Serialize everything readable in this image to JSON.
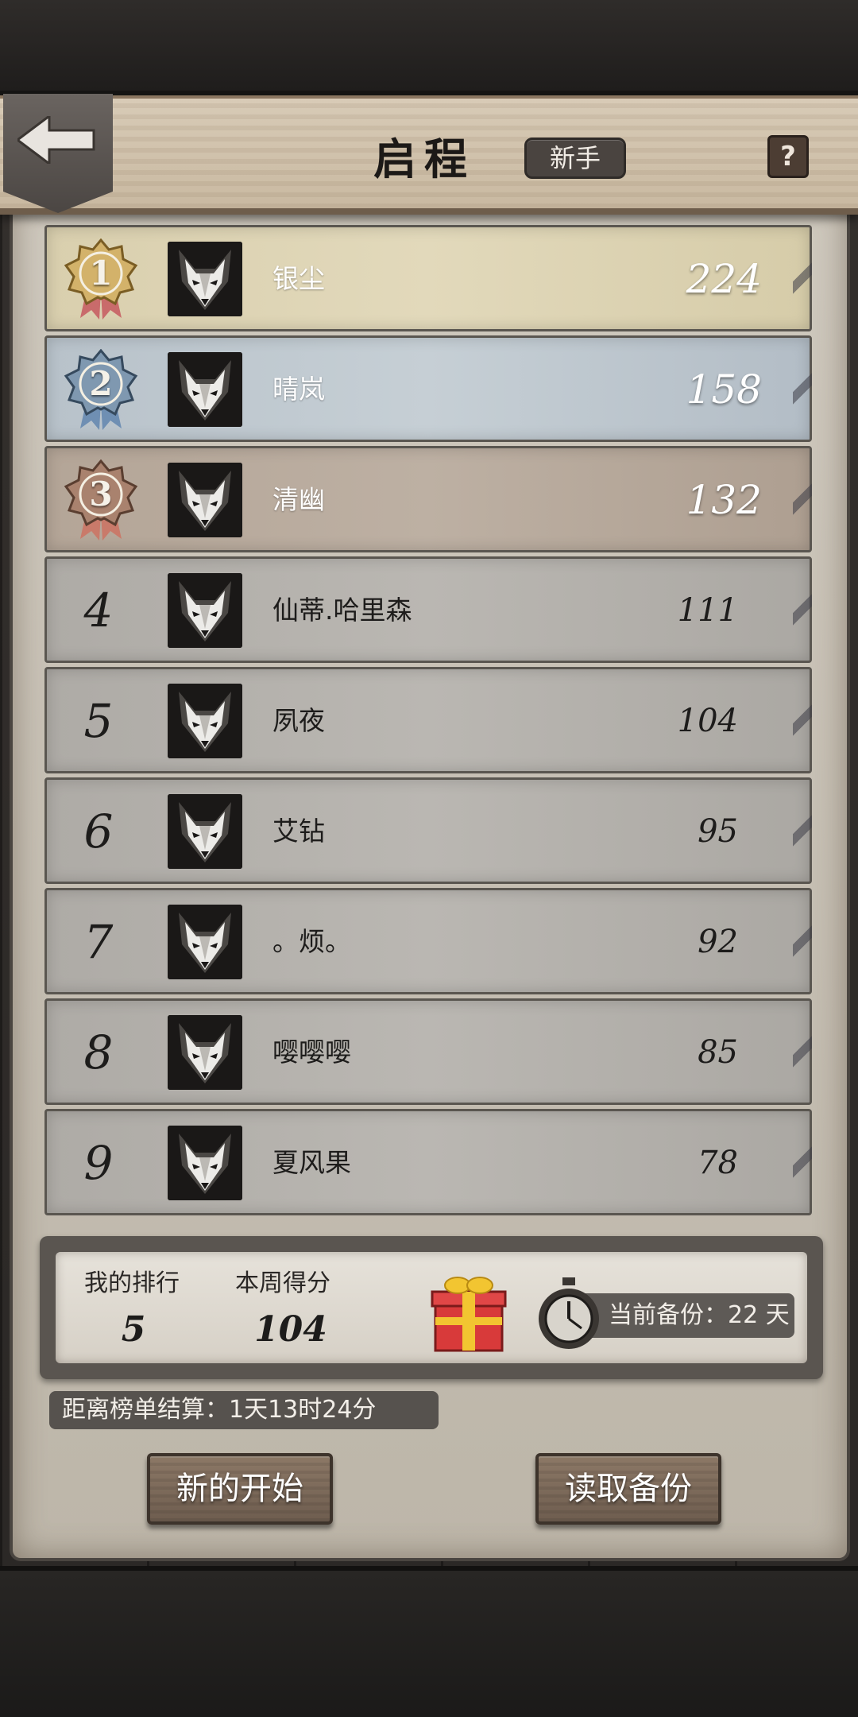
{
  "header": {
    "title": "启程",
    "difficulty": "新手",
    "help_label": "?"
  },
  "leaderboard": [
    {
      "rank": "1",
      "name": "银尘",
      "score": "224",
      "tier": "gold"
    },
    {
      "rank": "2",
      "name": "晴岚",
      "score": "158",
      "tier": "silver"
    },
    {
      "rank": "3",
      "name": "清幽",
      "score": "132",
      "tier": "bronze"
    },
    {
      "rank": "4",
      "name": "仙蒂.哈里森",
      "score": "111",
      "tier": "plain"
    },
    {
      "rank": "5",
      "name": "夙夜",
      "score": "104",
      "tier": "plain"
    },
    {
      "rank": "6",
      "name": "艾钻",
      "score": "95",
      "tier": "plain"
    },
    {
      "rank": "7",
      "name": "。烦。",
      "score": "92",
      "tier": "plain"
    },
    {
      "rank": "8",
      "name": "嘤嘤嘤",
      "score": "85",
      "tier": "plain"
    },
    {
      "rank": "9",
      "name": "夏风果",
      "score": "78",
      "tier": "plain"
    }
  ],
  "my_stats": {
    "rank_label": "我的排行",
    "rank_value": "5",
    "score_label": "本周得分",
    "score_value": "104",
    "backup_text": "当前备份：22 天"
  },
  "countdown_text": "距离榜单结算：1天13时24分",
  "buttons": {
    "new_start": "新的开始",
    "load_backup": "读取备份"
  },
  "colors": {
    "gold_row": "#e2d9bb",
    "silver_row": "#c6cfd5",
    "bronze_row": "#bdb0a3",
    "plain_row": "#bab7b2",
    "gift_red": "#d83a3a",
    "gift_ribbon": "#f2c531"
  }
}
